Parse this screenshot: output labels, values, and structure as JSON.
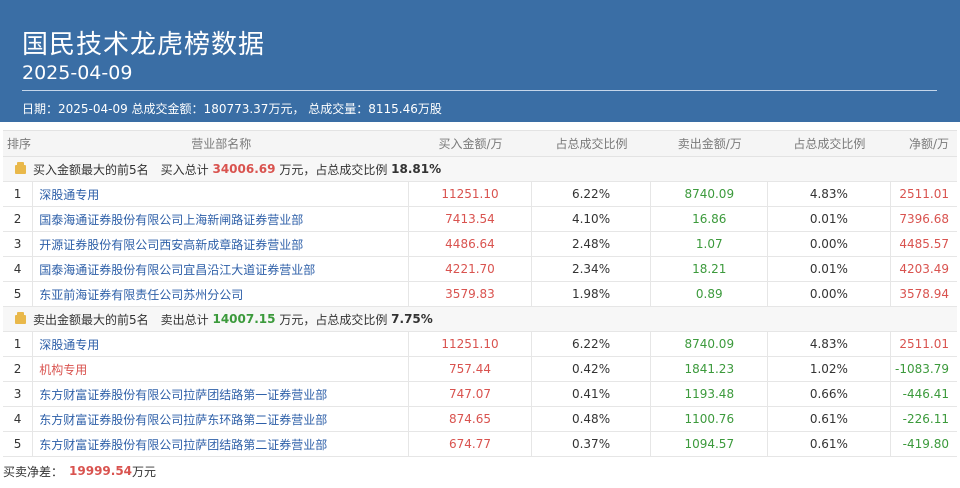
{
  "header": {
    "title": "国民技术龙虎榜数据",
    "date": "2025-04-09",
    "summary": "日期：2025-04-09 总成交金额：180773.37万元，  总成交量：8115.46万股"
  },
  "columns": {
    "rank": "排序",
    "name": "营业部名称",
    "buy": "买入金额/万",
    "buy_pct": "占总成交比例",
    "sell": "卖出金额/万",
    "sell_pct": "占总成交比例",
    "net": "净额/万"
  },
  "buy_section": {
    "label": "买入金额最大的前5名",
    "total_label": "买入总计",
    "total": "34006.69",
    "ratio_label": "万元，占总成交比例",
    "ratio": "18.81%"
  },
  "buy_rows": [
    {
      "rank": "1",
      "name": "深股通专用",
      "buy": "11251.10",
      "buy_pct": "6.22%",
      "sell": "8740.09",
      "sell_pct": "4.83%",
      "net": "2511.01"
    },
    {
      "rank": "2",
      "name": "国泰海通证券股份有限公司上海新闸路证券营业部",
      "buy": "7413.54",
      "buy_pct": "4.10%",
      "sell": "16.86",
      "sell_pct": "0.01%",
      "net": "7396.68"
    },
    {
      "rank": "3",
      "name": "开源证券股份有限公司西安高新成章路证券营业部",
      "buy": "4486.64",
      "buy_pct": "2.48%",
      "sell": "1.07",
      "sell_pct": "0.00%",
      "net": "4485.57"
    },
    {
      "rank": "4",
      "name": "国泰海通证券股份有限公司宜昌沿江大道证券营业部",
      "buy": "4221.70",
      "buy_pct": "2.34%",
      "sell": "18.21",
      "sell_pct": "0.01%",
      "net": "4203.49"
    },
    {
      "rank": "5",
      "name": "东亚前海证券有限责任公司苏州分公司",
      "buy": "3579.83",
      "buy_pct": "1.98%",
      "sell": "0.89",
      "sell_pct": "0.00%",
      "net": "3578.94"
    }
  ],
  "sell_section": {
    "label": "卖出金额最大的前5名",
    "total_label": "卖出总计",
    "total": "14007.15",
    "ratio_label": "万元，占总成交比例",
    "ratio": "7.75%"
  },
  "sell_rows": [
    {
      "rank": "1",
      "name": "深股通专用",
      "buy": "11251.10",
      "buy_pct": "6.22%",
      "sell": "8740.09",
      "sell_pct": "4.83%",
      "net": "2511.01"
    },
    {
      "rank": "2",
      "name": "机构专用",
      "buy": "757.44",
      "buy_pct": "0.42%",
      "sell": "1841.23",
      "sell_pct": "1.02%",
      "net": "-1083.79"
    },
    {
      "rank": "3",
      "name": "东方财富证券股份有限公司拉萨团结路第一证券营业部",
      "buy": "747.07",
      "buy_pct": "0.41%",
      "sell": "1193.48",
      "sell_pct": "0.66%",
      "net": "-446.41"
    },
    {
      "rank": "4",
      "name": "东方财富证券股份有限公司拉萨东环路第二证券营业部",
      "buy": "874.65",
      "buy_pct": "0.48%",
      "sell": "1100.76",
      "sell_pct": "0.61%",
      "net": "-226.11"
    },
    {
      "rank": "5",
      "name": "东方财富证券股份有限公司拉萨团结路第二证券营业部",
      "buy": "674.77",
      "buy_pct": "0.37%",
      "sell": "1094.57",
      "sell_pct": "0.61%",
      "net": "-419.80"
    }
  ],
  "footer": {
    "label": "买卖净差：",
    "value": "19999.54",
    "unit": "万元"
  },
  "colors": {
    "header_bg": "#3a6ea5",
    "buy_red": "#d9534f",
    "sell_green": "#3c9a3c",
    "link_blue": "#2d5fa8"
  }
}
